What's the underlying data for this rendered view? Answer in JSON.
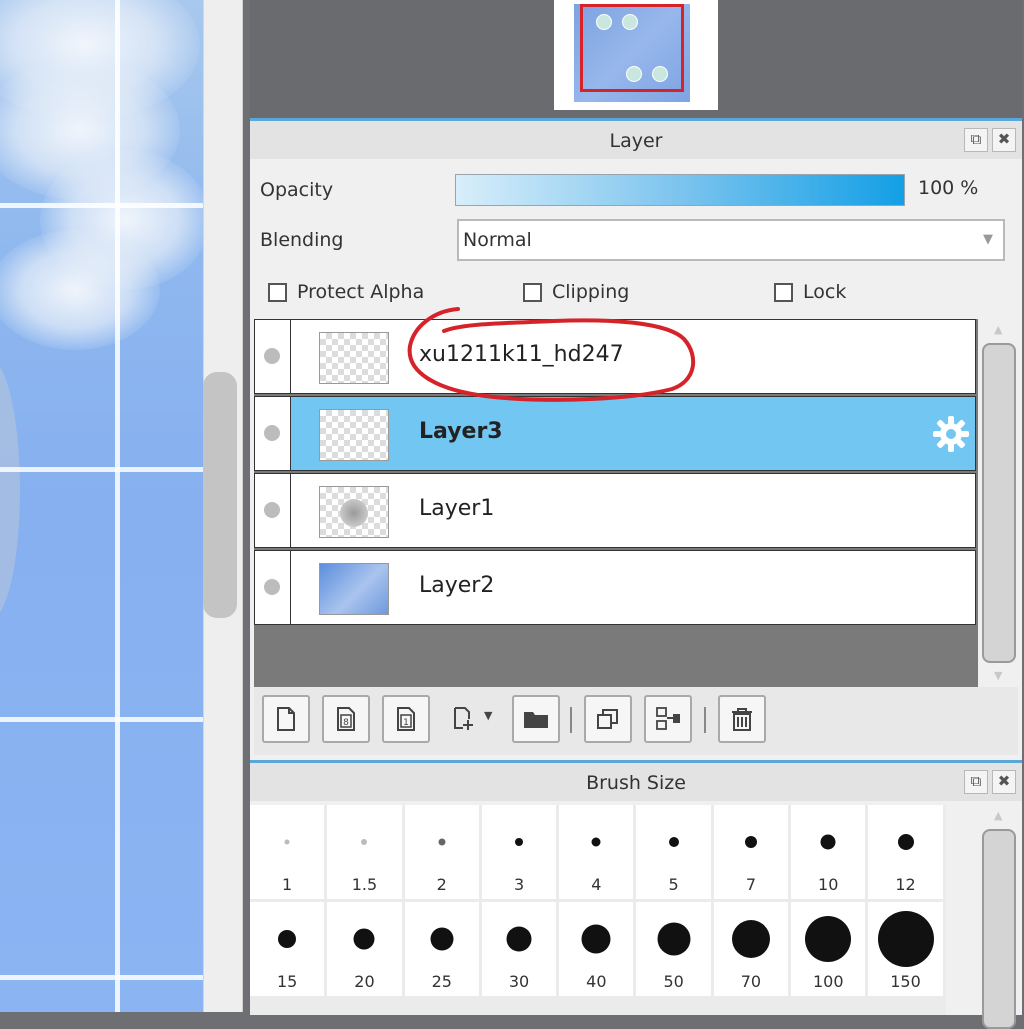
{
  "layer_panel": {
    "title": "Layer",
    "opacity_label": "Opacity",
    "opacity_value": "100 %",
    "opacity_fraction": 1.0,
    "blending_label": "Blending",
    "blending_value": "Normal",
    "checkboxes": {
      "protect_alpha": "Protect Alpha",
      "clipping": "Clipping",
      "lock": "Lock"
    },
    "layers": [
      {
        "name": "xu1211k11_hd247",
        "selected": false
      },
      {
        "name": "Layer3",
        "selected": true
      },
      {
        "name": "Layer1",
        "selected": false
      },
      {
        "name": "Layer2",
        "selected": false
      }
    ]
  },
  "brush_panel": {
    "title": "Brush Size",
    "sizes": [
      "1",
      "1.5",
      "2",
      "3",
      "4",
      "5",
      "7",
      "10",
      "12",
      "15",
      "20",
      "25",
      "30",
      "40",
      "50",
      "70",
      "100",
      "150"
    ]
  },
  "colors": {
    "accent": "#5aa8da",
    "selected_row": "#72c6f2",
    "annotation": "#d6232a"
  },
  "icons": {
    "panel_buttons": [
      "popout-icon",
      "close-icon"
    ],
    "layer_tools": [
      "new-layer-icon",
      "new-8bit-layer-icon",
      "new-1bit-layer-icon",
      "add-layer-menu-icon",
      "folder-icon",
      "duplicate-icon",
      "merge-down-icon",
      "delete-icon"
    ],
    "layer_settings": "gear-icon"
  }
}
